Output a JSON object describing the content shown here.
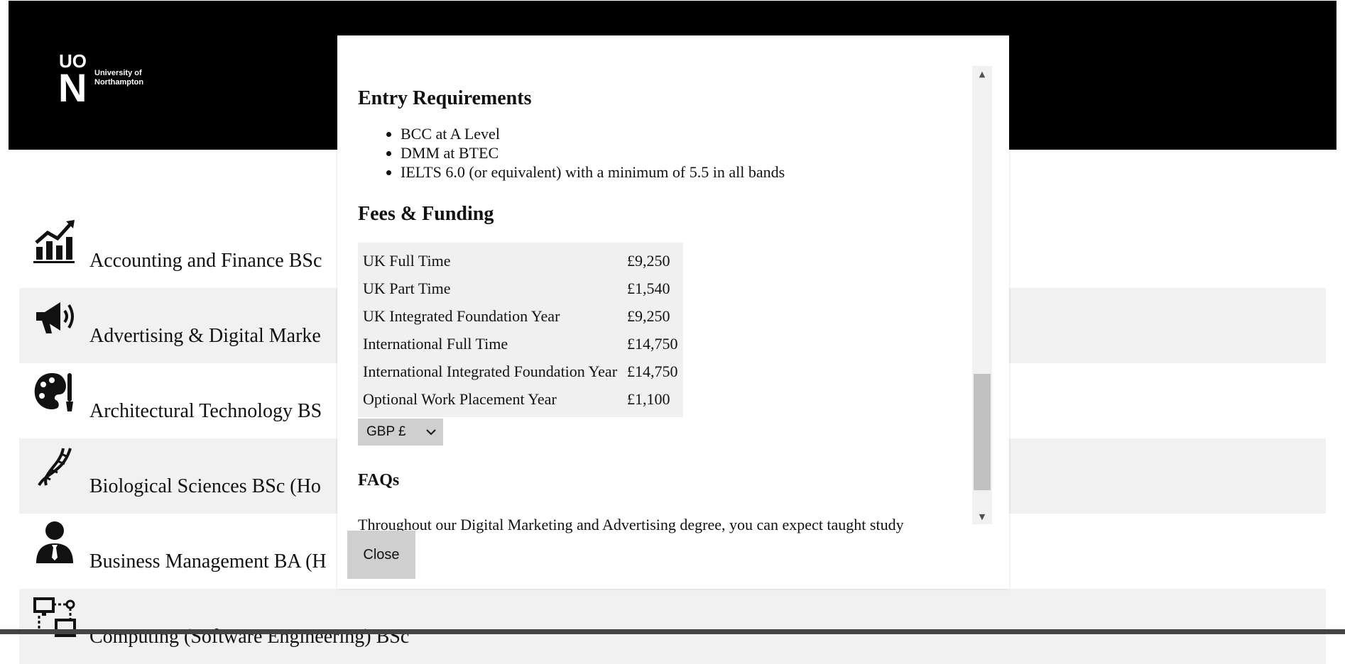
{
  "header": {
    "logo_mark": "UON",
    "logo_line1": "University of",
    "logo_line2": "Northampton"
  },
  "courses": [
    {
      "label": "Accounting and Finance BSc",
      "icon": "chart-growth-icon"
    },
    {
      "label": "Advertising & Digital Marke",
      "icon": "megaphone-icon"
    },
    {
      "label": "Architectural Technology BS",
      "icon": "palette-icon"
    },
    {
      "label": "Biological Sciences BSc (Ho",
      "icon": "dna-icon"
    },
    {
      "label": "Business Management BA (H",
      "icon": "businessman-icon"
    },
    {
      "label": "Computing (Software Engineering) BSc",
      "icon": "network-icon"
    }
  ],
  "modal": {
    "entry_heading": "Entry Requirements",
    "entry_items": [
      "BCC at A Level",
      "DMM at BTEC",
      "IELTS 6.0 (or equivalent) with a minimum of 5.5 in all bands"
    ],
    "fees_heading": "Fees & Funding",
    "fees_table": [
      {
        "label": "UK Full Time",
        "value": "£9,250"
      },
      {
        "label": "UK Part Time",
        "value": "£1,540"
      },
      {
        "label": "UK Integrated Foundation Year",
        "value": "£9,250"
      },
      {
        "label": "International Full Time",
        "value": "£14,750"
      },
      {
        "label": "International Integrated Foundation Year",
        "value": "£14,750"
      },
      {
        "label": "Optional Work Placement Year",
        "value": "£1,100"
      }
    ],
    "currency_selected": "GBP £",
    "faqs_heading": "FAQs",
    "faq_text": "Throughout our Digital Marketing and Advertising degree, you can expect taught study",
    "close_label": "Close"
  }
}
